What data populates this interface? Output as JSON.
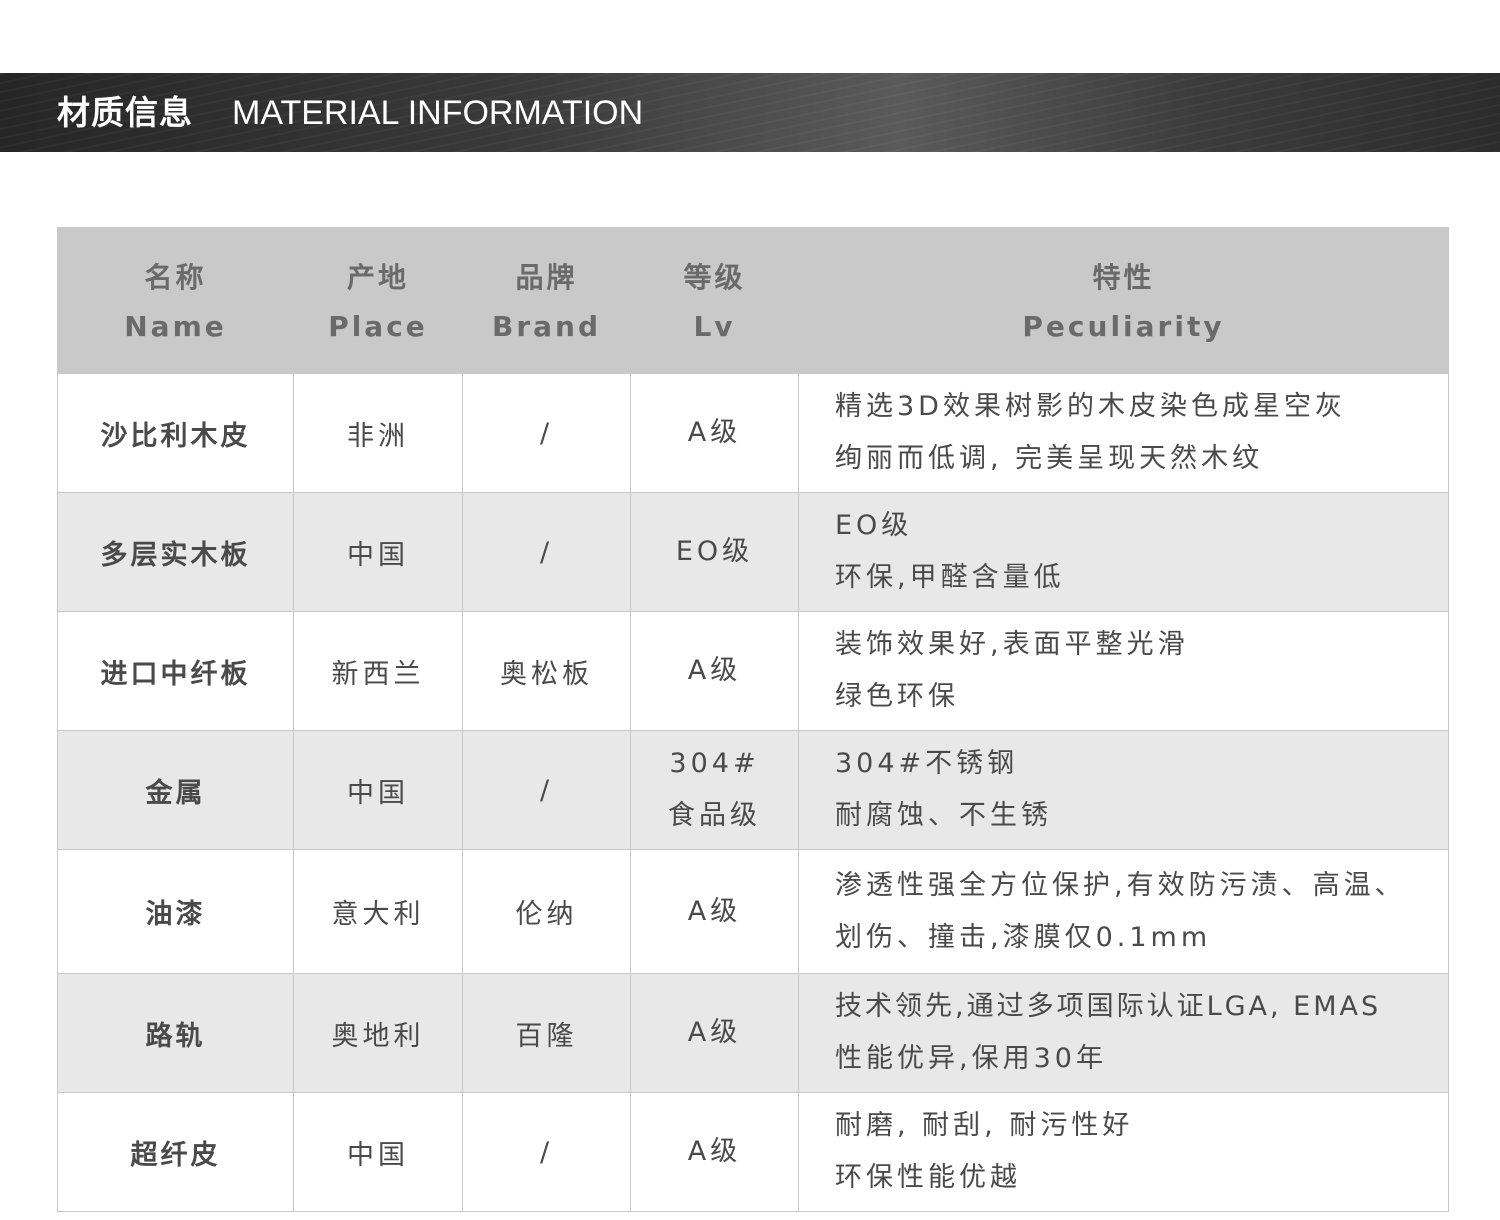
{
  "header": {
    "title_cn": "材质信息",
    "title_en": "MATERIAL INFORMATION"
  },
  "table": {
    "columns": [
      {
        "cn": "名称",
        "en": "Name"
      },
      {
        "cn": "产地",
        "en": "Place"
      },
      {
        "cn": "品牌",
        "en": "Brand"
      },
      {
        "cn": "等级",
        "en": "Lv"
      },
      {
        "cn": "特性",
        "en": "Peculiarity"
      }
    ],
    "rows": [
      {
        "name": "沙比利木皮",
        "place": "非洲",
        "brand": "/",
        "lv": [
          "A级"
        ],
        "features": [
          "精选3D效果树影的木皮染色成星空灰",
          "绚丽而低调, 完美呈现天然木纹"
        ]
      },
      {
        "name": "多层实木板",
        "place": "中国",
        "brand": "/",
        "lv": [
          "EO级"
        ],
        "features": [
          "EO级",
          "环保,甲醛含量低"
        ]
      },
      {
        "name": "进口中纤板",
        "place": "新西兰",
        "brand": "奥松板",
        "lv": [
          "A级"
        ],
        "features": [
          "装饰效果好,表面平整光滑",
          "绿色环保"
        ]
      },
      {
        "name": "金属",
        "place": "中国",
        "brand": "/",
        "lv": [
          "304#",
          "食品级"
        ],
        "features": [
          "304#不锈钢",
          "耐腐蚀、不生锈"
        ]
      },
      {
        "name": "油漆",
        "place": "意大利",
        "brand": "伦纳",
        "lv": [
          "A级"
        ],
        "features": [
          "渗透性强全方位保护,有效防污渍、高温、",
          "划伤、撞击,漆膜仅0.1mm"
        ]
      },
      {
        "name": "路轨",
        "place": "奥地利",
        "brand": "百隆",
        "lv": [
          "A级"
        ],
        "features": [
          "技术领先,通过多项国际认证LGA, EMAS",
          "性能优异,保用30年"
        ]
      },
      {
        "name": "超纤皮",
        "place": "中国",
        "brand": "/",
        "lv": [
          "A级"
        ],
        "features": [
          "耐磨, 耐刮, 耐污性好",
          "环保性能优越"
        ]
      }
    ]
  }
}
